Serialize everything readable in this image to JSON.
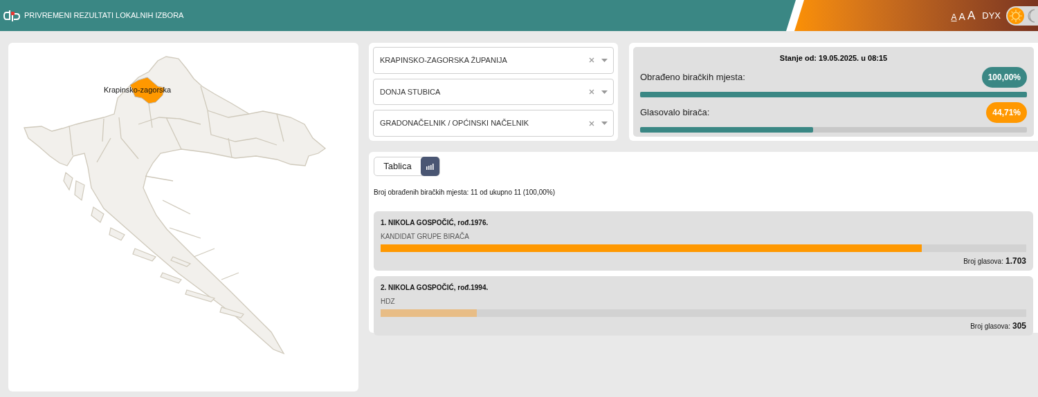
{
  "header": {
    "title": "PRIVREMENI REZULTATI LOKALNIH IZBORA",
    "font_size_buttons": [
      {
        "label": "A",
        "selected": true
      },
      {
        "label": "A",
        "selected": false
      },
      {
        "label": "A",
        "selected": false
      }
    ],
    "dyslexia_button": "DYX",
    "dark_mode": false
  },
  "map": {
    "region_label": "Krapinsko-zagorska"
  },
  "filters": [
    {
      "value": "KRAPINSKO-ZAGORSKA ŽUPANIJA"
    },
    {
      "value": "DONJA STUBICA"
    },
    {
      "value": "GRADONAČELNIK / OPĆINSKI NAČELNIK"
    }
  ],
  "status": {
    "timestamp": "Stanje od: 19.05.2025. u 08:15",
    "metrics": [
      {
        "label": "Obrađeno biračkih mjesta:",
        "badge": "100,00%",
        "color": "#3a8784",
        "level": 1.0
      },
      {
        "label": "Glasovalo birača:",
        "badge": "44,71%",
        "color": "#ff9800",
        "level": 0.447
      }
    ]
  },
  "results": {
    "view_tabs": [
      {
        "kind": "text",
        "label": "Tablica",
        "selected": false
      },
      {
        "kind": "chart",
        "selected": true
      }
    ],
    "summary": "Broj obrađenih biračkih mjesta: 11 od ukupno 11 (100,00%)",
    "candidates": [
      {
        "name": "1. NIKOLA GOSPOČIĆ, rođ.1976.",
        "list": "KANDIDAT GRUPE BIRAČA",
        "level": 0.838,
        "color": "#ff9800",
        "votes_label": "Broj glasova:",
        "votes": "1.703"
      },
      {
        "name": "2. NIKOLA GOSPOČIĆ, rođ.1994.",
        "list": "HDZ",
        "level": 0.149,
        "color": "#e8bd86",
        "votes_label": "Broj glasova:",
        "votes": "305"
      }
    ]
  }
}
